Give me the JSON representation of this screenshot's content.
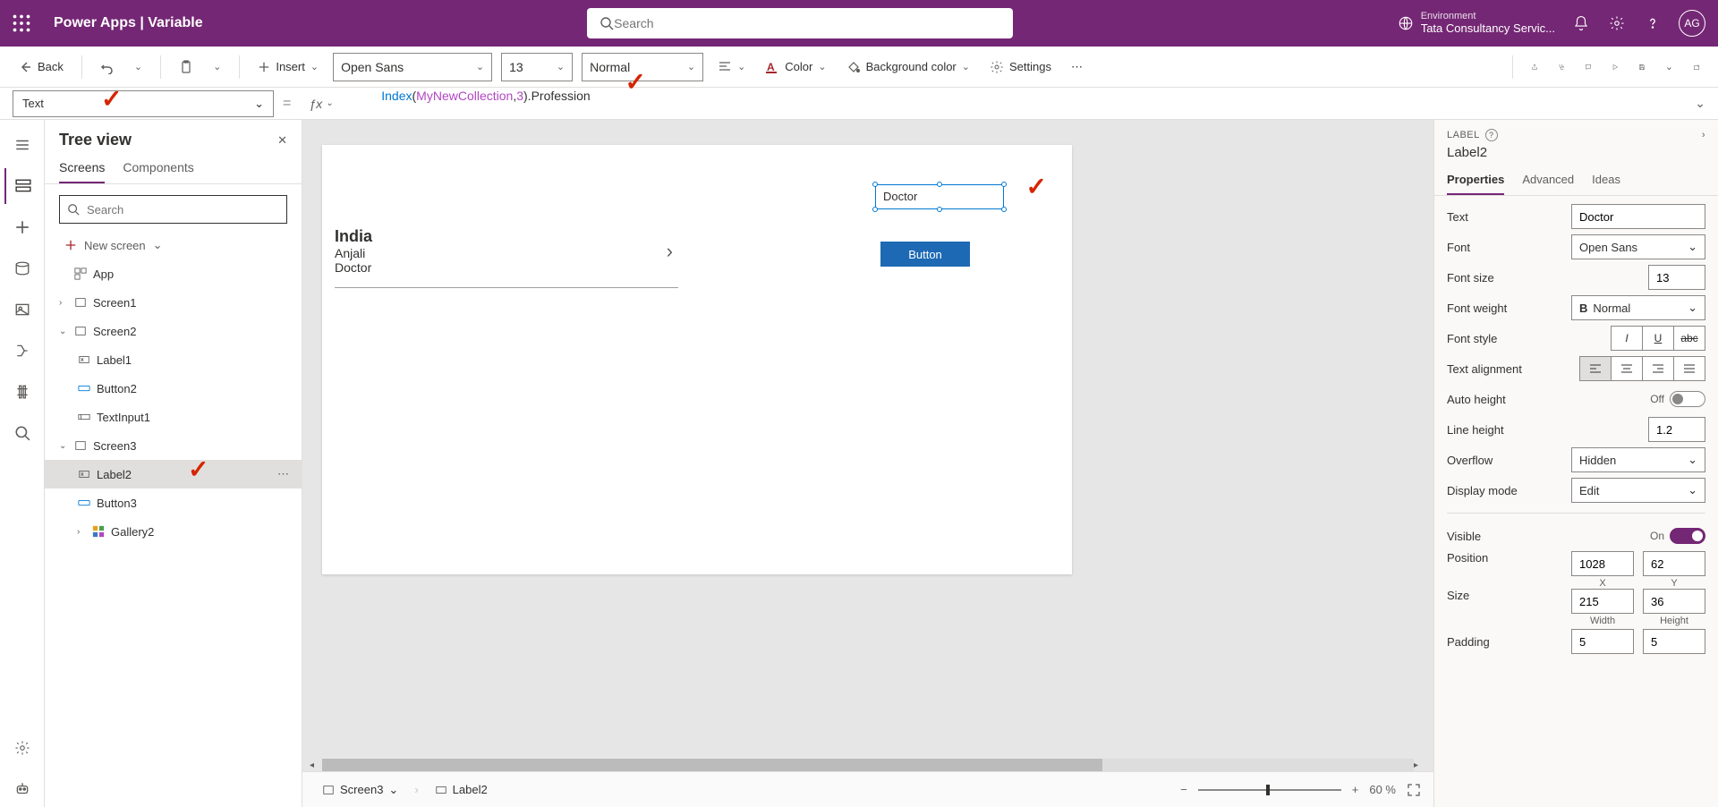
{
  "header": {
    "title": "Power Apps  |  Variable",
    "search_placeholder": "Search",
    "env_label": "Environment",
    "env_name": "Tata Consultancy Servic...",
    "avatar": "AG"
  },
  "toolbar": {
    "back": "Back",
    "insert": "Insert",
    "font": "Open Sans",
    "fontsize": "13",
    "weight": "Normal",
    "color": "Color",
    "bg": "Background color",
    "settings": "Settings"
  },
  "formula": {
    "prop": "Text",
    "tokens": [
      {
        "t": "fn",
        "v": "Index"
      },
      {
        "t": "plain",
        "v": "("
      },
      {
        "t": "id",
        "v": "MyNewCollection"
      },
      {
        "t": "plain",
        "v": ","
      },
      {
        "t": "num",
        "v": "3"
      },
      {
        "t": "plain",
        "v": ")."
      },
      {
        "t": "plain",
        "v": "Profession"
      }
    ]
  },
  "tree": {
    "title": "Tree view",
    "tab_screens": "Screens",
    "tab_components": "Components",
    "search_placeholder": "Search",
    "new_screen": "New screen",
    "nodes": {
      "app": "App",
      "s1": "Screen1",
      "s2": "Screen2",
      "l1": "Label1",
      "b2": "Button2",
      "ti1": "TextInput1",
      "s3": "Screen3",
      "l2": "Label2",
      "b3": "Button3",
      "g2": "Gallery2"
    }
  },
  "canvas": {
    "g_title": "India",
    "g_sub1": "Anjali",
    "g_sub2": "Doctor",
    "sel_label": "Doctor",
    "btn": "Button"
  },
  "status": {
    "crumb1": "Screen3",
    "crumb2": "Label2",
    "zoom": "60 %"
  },
  "props": {
    "type": "LABEL",
    "name": "Label2",
    "tab_props": "Properties",
    "tab_adv": "Advanced",
    "tab_ideas": "Ideas",
    "rows": {
      "text_l": "Text",
      "text_v": "Doctor",
      "font_l": "Font",
      "font_v": "Open Sans",
      "size_l": "Font size",
      "size_v": "13",
      "weight_l": "Font weight",
      "weight_v": "Normal",
      "style_l": "Font style",
      "align_l": "Text alignment",
      "autoh_l": "Auto height",
      "autoh_v": "Off",
      "lh_l": "Line height",
      "lh_v": "1.2",
      "ovf_l": "Overflow",
      "ovf_v": "Hidden",
      "disp_l": "Display mode",
      "disp_v": "Edit",
      "vis_l": "Visible",
      "vis_v": "On",
      "pos_l": "Position",
      "pos_x": "1028",
      "pos_y": "62",
      "cap_x": "X",
      "cap_y": "Y",
      "sz_l": "Size",
      "sz_w": "215",
      "sz_h": "36",
      "cap_w": "Width",
      "cap_h": "Height",
      "pad_l": "Padding",
      "pad_a": "5",
      "pad_b": "5"
    }
  }
}
